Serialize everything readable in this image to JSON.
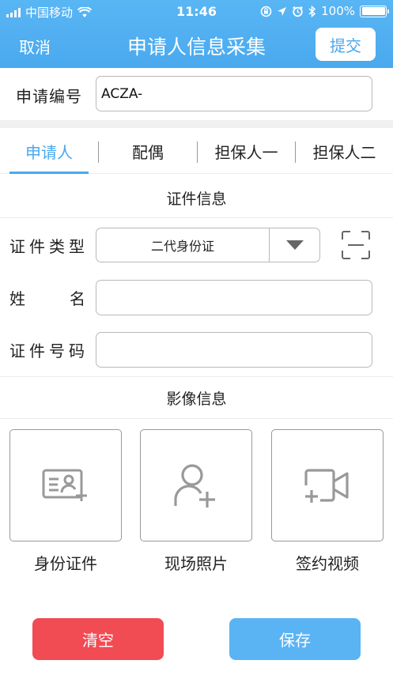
{
  "status_bar": {
    "carrier": "中国移动",
    "time": "11:46",
    "battery": "100%"
  },
  "nav": {
    "cancel": "取消",
    "title": "申请人信息采集",
    "submit": "提交"
  },
  "application": {
    "label": "申请编号",
    "value": "ACZA-"
  },
  "tabs": [
    {
      "label": "申请人",
      "active": true
    },
    {
      "label": "配偶",
      "active": false
    },
    {
      "label": "担保人一",
      "active": false
    },
    {
      "label": "担保人二",
      "active": false
    }
  ],
  "id_section": {
    "title": "证件信息",
    "id_type_label": "证件类型",
    "id_type_value": "二代身份证",
    "name_label": "姓名",
    "name_value": "",
    "id_number_label": "证件号码",
    "id_number_value": ""
  },
  "image_section": {
    "title": "影像信息",
    "cards": [
      {
        "label": "身份证件",
        "icon": "id-card-add-icon"
      },
      {
        "label": "现场照片",
        "icon": "user-add-icon"
      },
      {
        "label": "签约视频",
        "icon": "video-add-icon"
      }
    ]
  },
  "actions": {
    "clear": "清空",
    "save": "保存"
  },
  "colors": {
    "primary": "#4aa9ee",
    "danger": "#f14b53",
    "save": "#5ab4f4"
  }
}
